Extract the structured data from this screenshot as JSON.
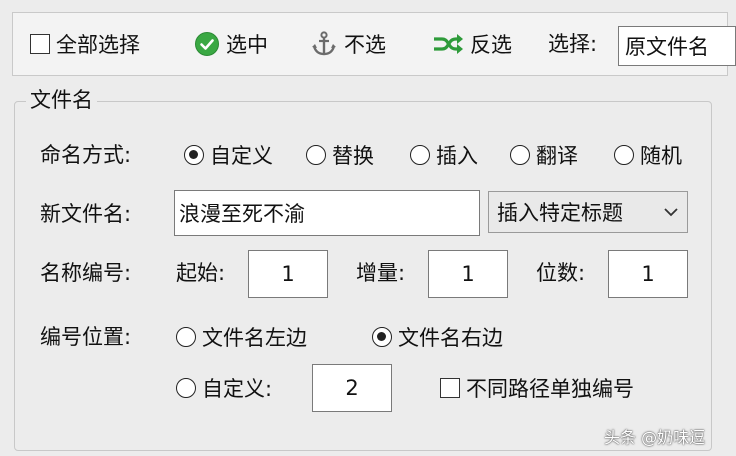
{
  "toolbar": {
    "select_all_label": "全部选择",
    "select_label": "选中",
    "unselect_label": "不选",
    "invert_label": "反选",
    "choose_label": "选择:",
    "choose_value": "原文件名"
  },
  "filename_group": {
    "title": "文件名",
    "naming_mode": {
      "label": "命名方式:",
      "options": [
        "自定义",
        "替换",
        "插入",
        "翻译",
        "随机"
      ],
      "selected": "自定义"
    },
    "new_name": {
      "label": "新文件名:",
      "value": "浪漫至死不渝",
      "insert_title_label": "插入特定标题"
    },
    "numbering": {
      "label": "名称编号:",
      "start_label": "起始:",
      "start_value": "1",
      "step_label": "增量:",
      "step_value": "1",
      "digits_label": "位数:",
      "digits_value": "1"
    },
    "position": {
      "label": "编号位置:",
      "left_label": "文件名左边",
      "right_label": "文件名右边",
      "custom_label": "自定义:",
      "custom_value": "2",
      "separate_label": "不同路径单独编号",
      "selected": "文件名右边"
    }
  },
  "watermark": "头条 @奶味逗",
  "colors": {
    "check_green": "#3aa843",
    "anchor_gray": "#6b6b6b",
    "invert_green": "#2e9b3a",
    "window_bg": "#ececec"
  }
}
